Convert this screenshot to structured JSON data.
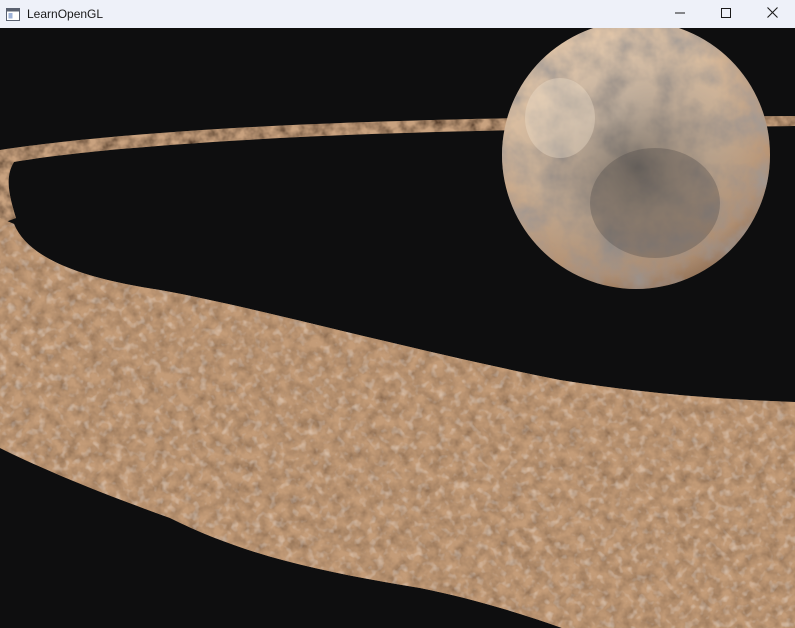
{
  "window": {
    "title": "LearnOpenGL",
    "icon": "app-window-icon",
    "controls": [
      {
        "name": "minimize-button",
        "icon": "minimize-icon"
      },
      {
        "name": "maximize-button",
        "icon": "maximize-icon"
      },
      {
        "name": "close-button",
        "icon": "close-icon"
      }
    ]
  },
  "scene": {
    "background_color": "#0e0e0f",
    "planet_color": "#d8b99b",
    "asteroid_color": "#c8a07e",
    "objects": [
      "planet",
      "asteroid-belt"
    ]
  }
}
